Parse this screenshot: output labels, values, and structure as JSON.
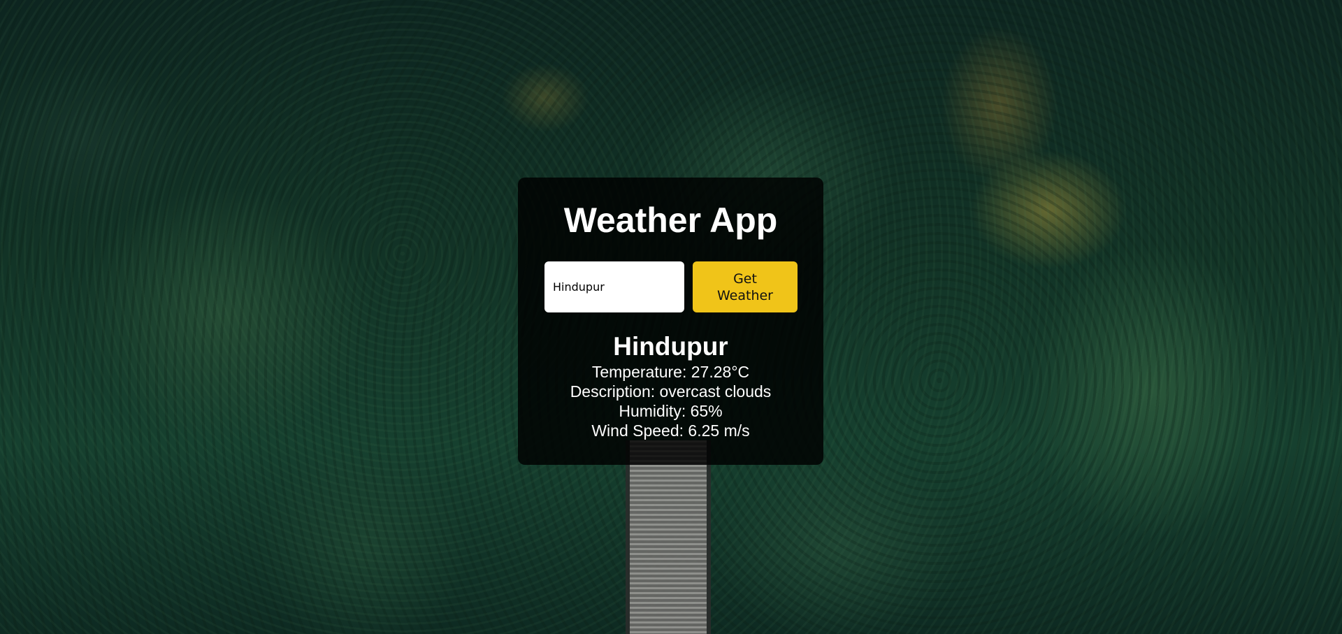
{
  "app": {
    "title": "Weather App"
  },
  "search": {
    "value": "Hindupur",
    "button_label": "Get Weather"
  },
  "result": {
    "city": "Hindupur",
    "temperature": "Temperature: 27.28°C",
    "description": "Description: overcast clouds",
    "humidity": "Humidity: 65%",
    "wind_speed": "Wind Speed: 6.25 m/s"
  },
  "colors": {
    "accent": "#f0c419",
    "card_background": "#000000",
    "text": "#ffffff"
  }
}
